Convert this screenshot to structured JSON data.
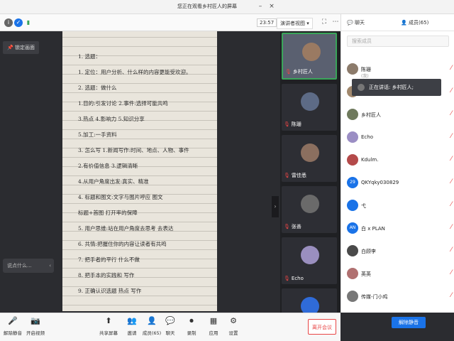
{
  "window": {
    "title": "您正在观看乡村匠人的屏幕"
  },
  "toolbar": {
    "timer": "23:57",
    "view_label": "演讲者视图"
  },
  "share": {
    "pin_label": "锁定画面",
    "chat_placeholder": "说点什么...",
    "notes": [
      "1. 选题：",
      "1. 定位：用户分析、什么样的内容更能受欢迎。",
      "2. 选题：做什么 ",
      "    1.目的:引发讨论 2.事件:选择可能共鸣",
      "    3.热点 4.影响力 5.知识分享",
      "    5.加工:一手资料",
      "3. 怎么写  1.新闻写作:时间、地点、人物、事件",
      "    2.有价值信息 3.逻辑清晰",
      "    4.从用户角度出发:真实、精准",
      "4. 标题和图文:文字与图片呼应 图文",
      "    标题+首图 打开率的保障",
      "5. 用户思维:站在用户角度去思考 去表达",
      "6. 共情:把握住你的内容让读者有共鸣",
      "7. 把手者的平行 什么不做",
      "8. 把手本的实践和 写作",
      "9. 正确认识选题 热点 写作"
    ]
  },
  "videos": [
    {
      "name": "乡村匠人"
    },
    {
      "name": "陈珊"
    },
    {
      "name": "雷佳悉"
    },
    {
      "name": "张善"
    },
    {
      "name": "Echo"
    },
    {
      "name": ""
    }
  ],
  "panel": {
    "tab_chat": "聊天",
    "tab_members": "成员(65)",
    "search_placeholder": "搜索成员",
    "speaking_label": "正在讲话: 乡村匠人;",
    "members": [
      {
        "name": "陈珊",
        "sub": "(我)",
        "avatar": "",
        "color": "#8c7b6b"
      },
      {
        "name": "",
        "sub": "",
        "avatar": "",
        "color": "#a1886d"
      },
      {
        "name": "乡村匠人",
        "sub": "",
        "avatar": "",
        "color": "#6f7a5d"
      },
      {
        "name": "Echo",
        "sub": "",
        "avatar": "",
        "color": "#9b8ec4"
      },
      {
        "name": "Kdulm.",
        "sub": "",
        "avatar": "",
        "color": "#b44a4a"
      },
      {
        "name": "QKYqky030829",
        "sub": "",
        "avatar": "29",
        "color": "#1a73e8"
      },
      {
        "name": "弋",
        "sub": "",
        "avatar": "",
        "color": "#1a73e8"
      },
      {
        "name": "白 x PLAN",
        "sub": "",
        "avatar": "AN",
        "color": "#1a73e8"
      },
      {
        "name": "白顾李",
        "sub": "",
        "avatar": "",
        "color": "#4a4a4a"
      },
      {
        "name": "英英",
        "sub": "",
        "avatar": "",
        "color": "#b07070"
      },
      {
        "name": "传媒-门小鸡",
        "sub": "",
        "avatar": "",
        "color": "#777"
      }
    ],
    "unmute_all": "解除静音"
  },
  "bottom": {
    "unmute": "解除静音",
    "start_video": "开启视频",
    "share_screen": "共享屏幕",
    "invite": "邀请",
    "members": "成员(65)",
    "chat": "聊天",
    "record": "录制",
    "apps": "应用",
    "settings": "设置",
    "leave": "离开会议"
  },
  "colors": {
    "accent": "#1a73e8",
    "danger": "#e84545",
    "active": "#3aa55a"
  }
}
